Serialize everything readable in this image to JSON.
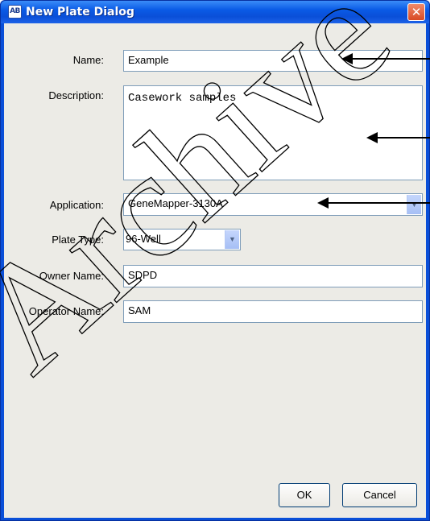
{
  "window": {
    "title": "New Plate Dialog",
    "icon_text": "AB",
    "close_symbol": "✕"
  },
  "form": {
    "name_label": "Name:",
    "name_value": "Example",
    "description_label": "Description:",
    "description_value": "Casework samples",
    "application_label": "Application:",
    "application_value": "GeneMapper-3130A",
    "plate_type_label": "Plate Type:",
    "plate_type_value": "96-Well",
    "owner_label": "Owner Name:",
    "owner_value": "SDPD",
    "operator_label": "Operator Name:",
    "operator_value": "SAM"
  },
  "buttons": {
    "ok_label": "OK",
    "cancel_label": "Cancel"
  },
  "icons": {
    "dropdown": "chevron-down-icon",
    "close": "close-icon",
    "annotation": "arrow-left-icon"
  },
  "watermark": {
    "text": "Archive"
  },
  "colors": {
    "title_bar": "#0a4fd8",
    "close_button": "#d84a24",
    "dialog_background": "#ecebe6",
    "field_border": "#7f9db9"
  }
}
